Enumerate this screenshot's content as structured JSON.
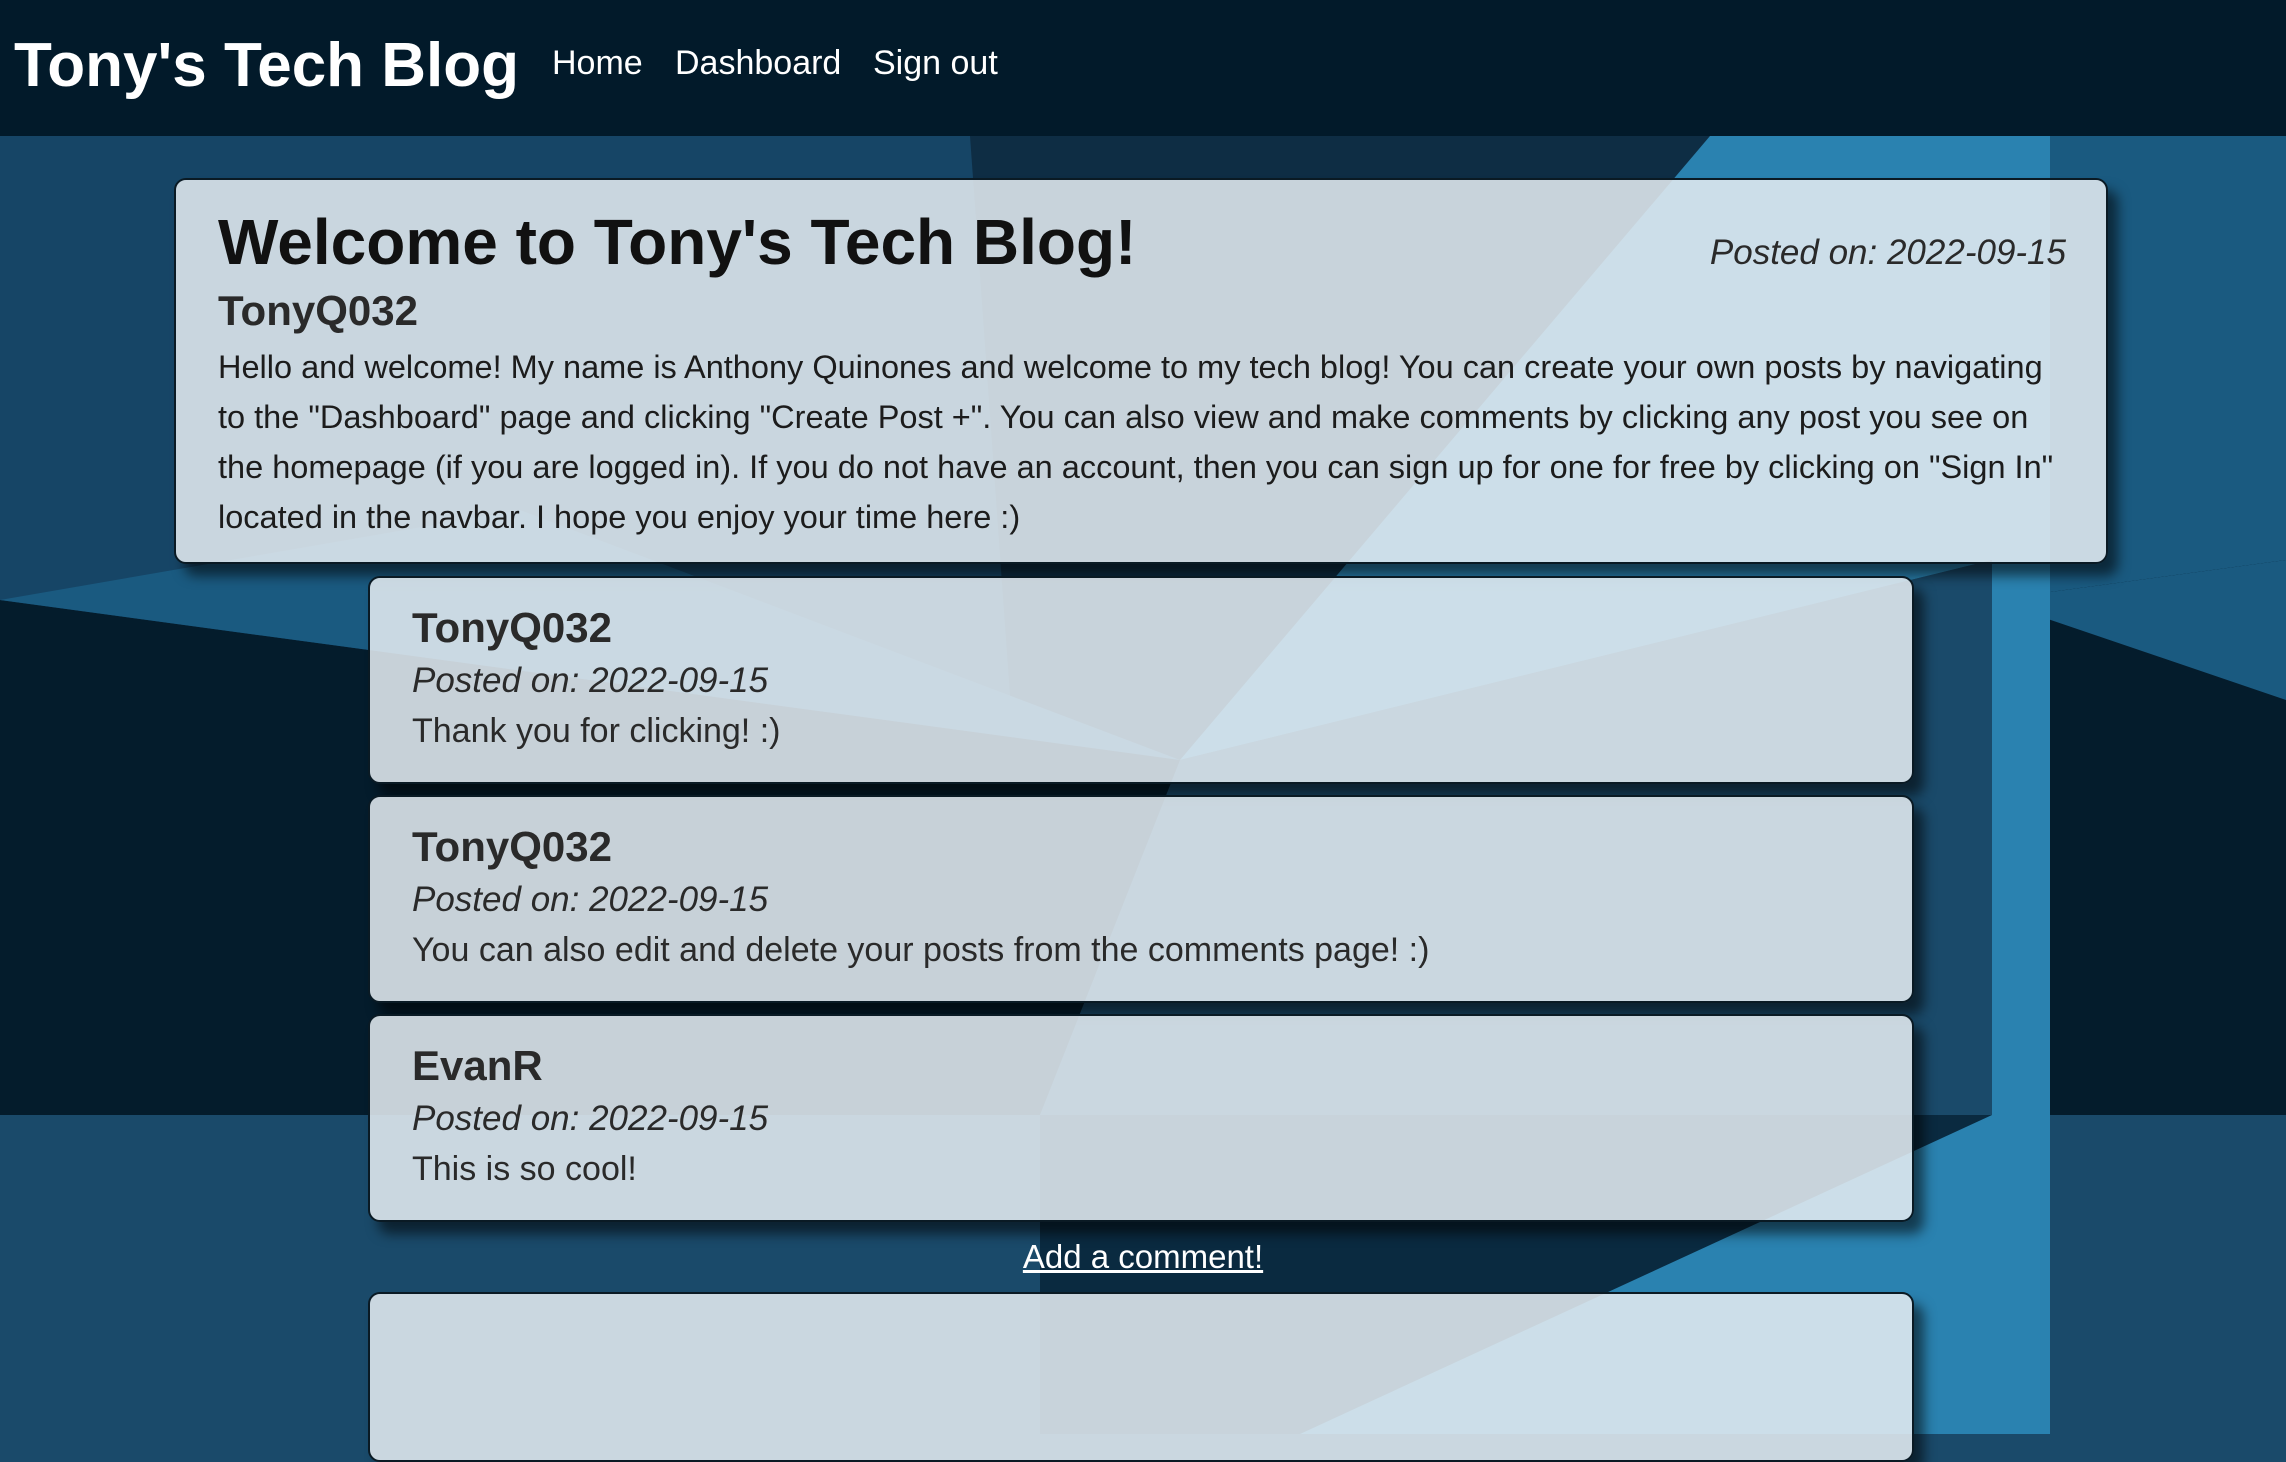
{
  "app": {
    "brand": "Tony's Tech Blog"
  },
  "nav": {
    "home": "Home",
    "dashboard": "Dashboard",
    "sign_out": "Sign out"
  },
  "post": {
    "title": "Welcome to Tony's Tech Blog!",
    "date": "Posted on: 2022-09-15",
    "author": "TonyQ032",
    "body": "Hello and welcome! My name is Anthony Quinones and welcome to my tech blog! You can create your own posts by navigating to the \"Dashboard\" page and clicking \"Create Post +\". You can also view and make comments by clicking any post you see on the homepage (if you are logged in). If you do not have an account, then you can sign up for one for free by clicking on \"Sign In\" located in the navbar. I hope you enjoy your time here :)"
  },
  "comments": [
    {
      "author": "TonyQ032",
      "date": "Posted on: 2022-09-15",
      "text": "Thank you for clicking! :)"
    },
    {
      "author": "TonyQ032",
      "date": "Posted on: 2022-09-15",
      "text": "You can also edit and delete your posts from the comments page! :)"
    },
    {
      "author": "EvanR",
      "date": "Posted on: 2022-09-15",
      "text": "This is so cool!"
    }
  ],
  "add_comment": {
    "label": "Add a comment!"
  },
  "colors": {
    "navbar": "#021a2a",
    "background_dark": "#041c2c",
    "background_mid": "#1a4a6a",
    "background_light": "#2a82b0",
    "card": "#e2eaf0",
    "link_text": "#ffffff"
  }
}
